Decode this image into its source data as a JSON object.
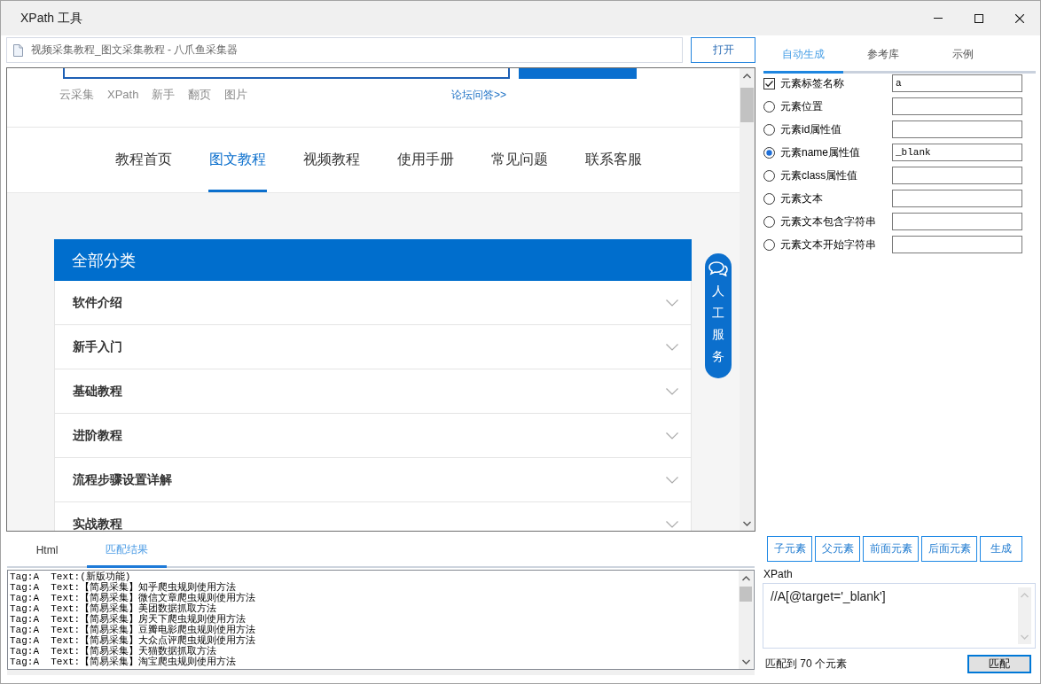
{
  "window": {
    "title": "XPath 工具"
  },
  "address_bar": {
    "value": "视频采集教程_图文采集教程 - 八爪鱼采集器",
    "open_button": "打开"
  },
  "web_page": {
    "quick_links": [
      "云采集",
      "XPath",
      "新手",
      "翻页",
      "图片"
    ],
    "forum_link": "论坛问答>>",
    "nav": [
      {
        "label": "教程首页",
        "selected": false
      },
      {
        "label": "图文教程",
        "selected": true
      },
      {
        "label": "视频教程",
        "selected": false
      },
      {
        "label": "使用手册",
        "selected": false
      },
      {
        "label": "常见问题",
        "selected": false
      },
      {
        "label": "联系客服",
        "selected": false
      }
    ],
    "category_panel": {
      "title": "全部分类",
      "items": [
        "软件介绍",
        "新手入门",
        "基础教程",
        "进阶教程",
        "流程步骤设置详解",
        "实战教程"
      ]
    },
    "service_button": "人工服务"
  },
  "result_tabs": [
    {
      "label": "Html",
      "selected": false
    },
    {
      "label": "匹配结果",
      "selected": true
    }
  ],
  "match_results": [
    "Tag:A  Text:(新版功能)",
    "Tag:A  Text:【简易采集】知乎爬虫规则使用方法",
    "Tag:A  Text:【简易采集】微信文章爬虫规则使用方法",
    "Tag:A  Text:【简易采集】美团数据抓取方法",
    "Tag:A  Text:【简易采集】房天下爬虫规则使用方法",
    "Tag:A  Text:【简易采集】豆瓣电影爬虫规则使用方法",
    "Tag:A  Text:【简易采集】大众点评爬虫规则使用方法",
    "Tag:A  Text:【简易采集】天猫数据抓取方法",
    "Tag:A  Text:【简易采集】淘宝爬虫规则使用方法"
  ],
  "generator_tabs": [
    {
      "label": "自动生成",
      "selected": true
    },
    {
      "label": "参考库",
      "selected": false
    },
    {
      "label": "示例",
      "selected": false
    }
  ],
  "conditions": [
    {
      "kind": "checkbox",
      "label": "元素标签名称",
      "checked": true,
      "value": "a"
    },
    {
      "kind": "radio",
      "label": "元素位置",
      "selected": false
    },
    {
      "kind": "radio",
      "label": "元素id属性值",
      "selected": false
    },
    {
      "kind": "radio",
      "label": "元素name属性值",
      "selected": true,
      "value": "_blank"
    },
    {
      "kind": "radio",
      "label": "元素class属性值",
      "selected": false
    },
    {
      "kind": "radio",
      "label": "元素文本",
      "selected": false
    },
    {
      "kind": "radio",
      "label": "元素文本包含字符串",
      "selected": false
    },
    {
      "kind": "radio",
      "label": "元素文本开始字符串",
      "selected": false
    }
  ],
  "node_buttons": [
    "子元素",
    "父元素",
    "前面元素",
    "后面元素",
    "生成"
  ],
  "xpath": {
    "label": "XPath",
    "value": "//A[@target='_blank']"
  },
  "match": {
    "summary": "匹配到 70 个元素",
    "button": "匹配"
  }
}
